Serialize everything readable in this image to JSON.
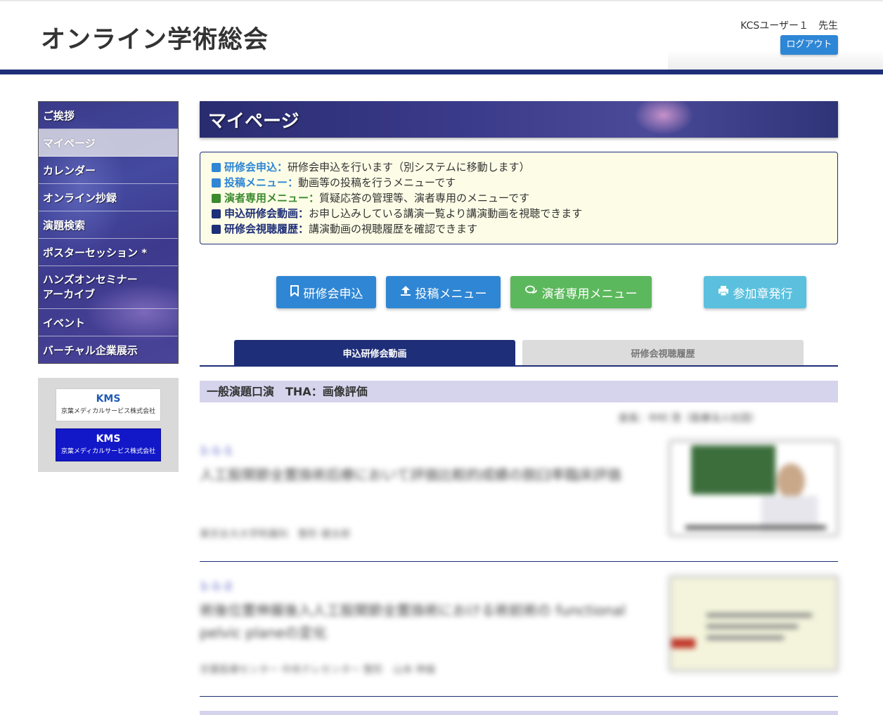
{
  "header": {
    "site_title": "オンライン学術総会",
    "user_label": "KCSユーザー１　先生",
    "logout_label": "ログアウト"
  },
  "sidebar": {
    "items": [
      {
        "label": "ご挨拶"
      },
      {
        "label": "マイページ",
        "active": true
      },
      {
        "label": "カレンダー"
      },
      {
        "label": "オンライン抄録"
      },
      {
        "label": "演題検索"
      },
      {
        "label": "ポスターセッション *"
      },
      {
        "label_line1": "ハンズオンセミナー",
        "label_line2": "アーカイブ"
      },
      {
        "label": "イベント"
      },
      {
        "label": "バーチャル企業展示"
      }
    ],
    "banners": [
      {
        "title": "KMS",
        "subtitle": "京葉メディカルサービス株式会社"
      },
      {
        "title": "KMS",
        "subtitle": "京葉メディカルサービス株式会社"
      }
    ]
  },
  "main": {
    "page_title": "マイページ",
    "info": [
      {
        "key": "研修会申込：",
        "text": "研修会申込を行います（別システムに移動します）",
        "color": "#2f86d4"
      },
      {
        "key": "投稿メニュー：",
        "text": "動画等の投稿を行うメニューです",
        "color": "#2f86d4"
      },
      {
        "key": "演者専用メニュー：",
        "text": "質疑応答の管理等、演者専用のメニューです",
        "color": "#3a8a2e"
      },
      {
        "key": "申込研修会動画：",
        "text": "お申し込みしている講演一覧より講演動画を視聴できます",
        "color": "#1e2e78"
      },
      {
        "key": "研修会視聴履歴：",
        "text": "講演動画の視聴履歴を確認できます",
        "color": "#1e2e78"
      }
    ],
    "buttons": {
      "apply": "研修会申込",
      "post": "投稿メニュー",
      "speaker": "演者専用メニュー",
      "certificate": "参加章発行"
    },
    "tabs": {
      "active": "申込研修会動画",
      "inactive": "研修会視聴履歴"
    },
    "session_title": "一般演題口演　THA：画像評価",
    "chair_blurred": "座長：中村 茂（医療法人社団）",
    "items": [
      {
        "no": "1-1-1",
        "title": "人工股関節全置換術后療において評価比較的成績の脱臼率臨床評価",
        "authors": "東京女大大学附属科　整形 健太郎"
      },
      {
        "no": "1-1-2",
        "title": "術後位置伸展後入人工股関節全置換術における術前術の functional pelvic planeの変化",
        "authors": "京葉医療センター 中央テレセンター 整形　山本 伸雄"
      }
    ]
  }
}
